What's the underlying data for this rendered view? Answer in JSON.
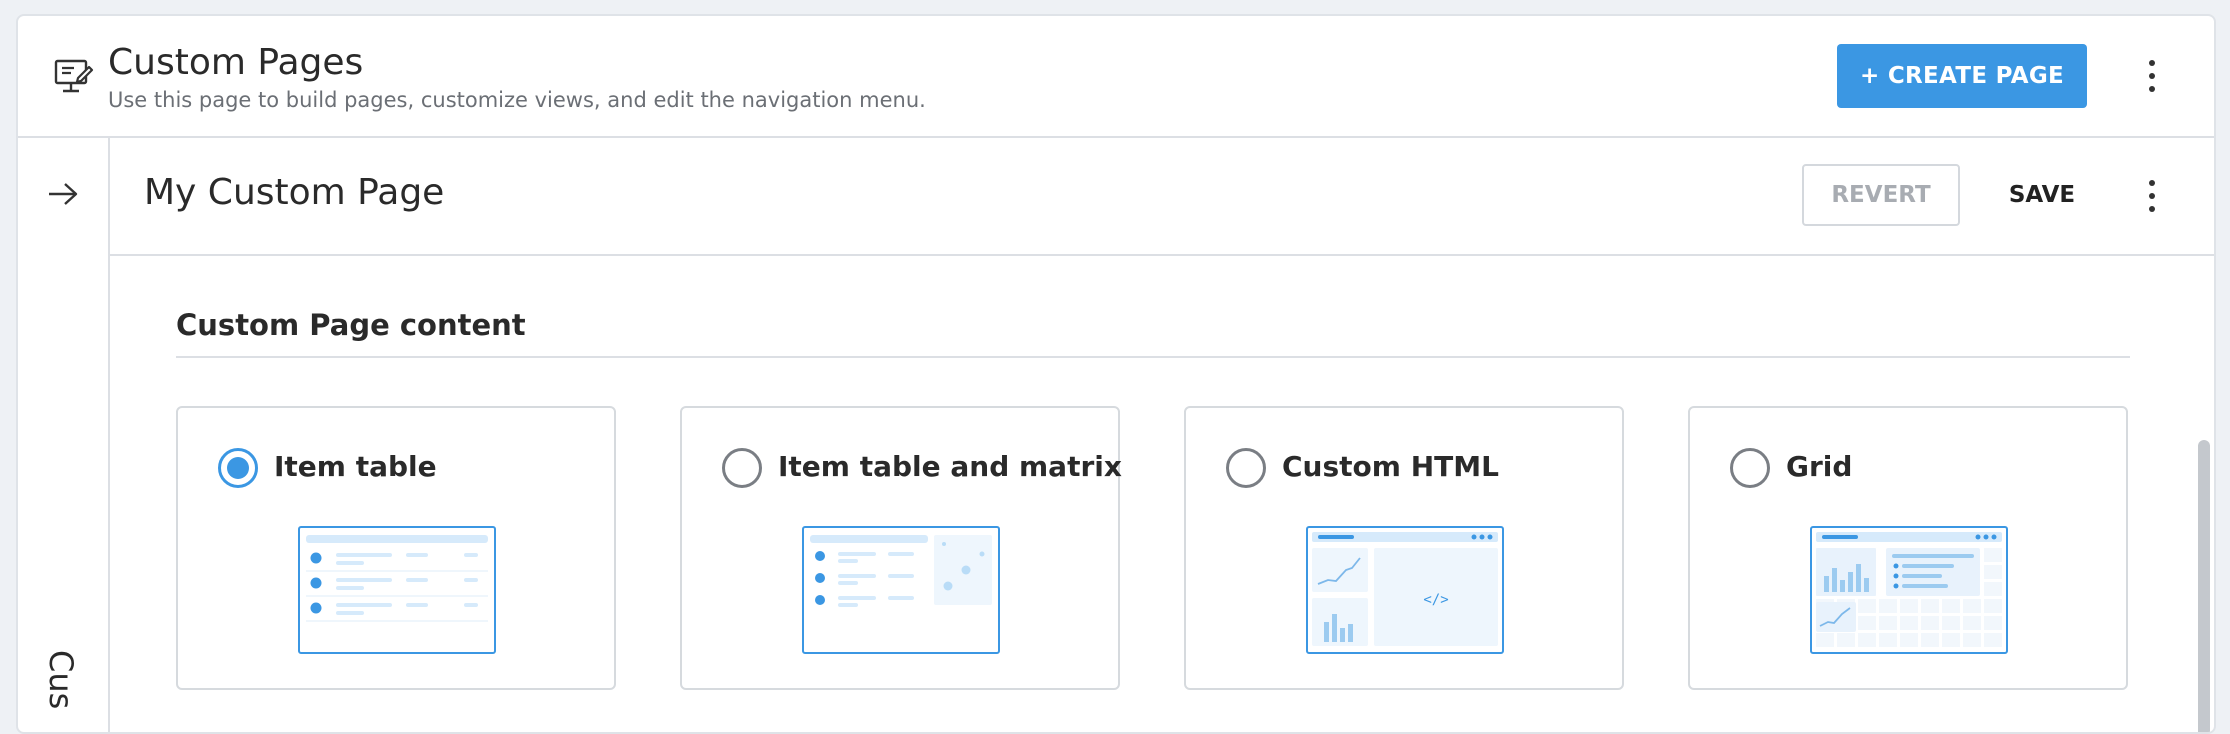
{
  "header": {
    "title": "Custom Pages",
    "subtitle": "Use this page to build pages, customize views, and edit the navigation menu.",
    "create_label": "+ CREATE PAGE",
    "icon": "monitor-edit-icon"
  },
  "subbar": {
    "page_name": "My Custom Page",
    "revert_label": "REVERT",
    "save_label": "SAVE"
  },
  "rail": {
    "vertical_text": "Cus",
    "icon": "arrow-right-icon"
  },
  "content": {
    "section_title": "Custom Page content",
    "options": [
      {
        "label": "Item table",
        "selected": true,
        "thumbnail": "item-table-thumbnail"
      },
      {
        "label": "Item table and matrix",
        "selected": false,
        "thumbnail": "item-table-matrix-thumbnail"
      },
      {
        "label": "Custom HTML",
        "selected": false,
        "thumbnail": "custom-html-thumbnail"
      },
      {
        "label": "Grid",
        "selected": false,
        "thumbnail": "grid-thumbnail"
      }
    ]
  },
  "colors": {
    "accent": "#3b97e3",
    "thumbnail_light": "#d6eafb",
    "border": "#d6dade"
  }
}
